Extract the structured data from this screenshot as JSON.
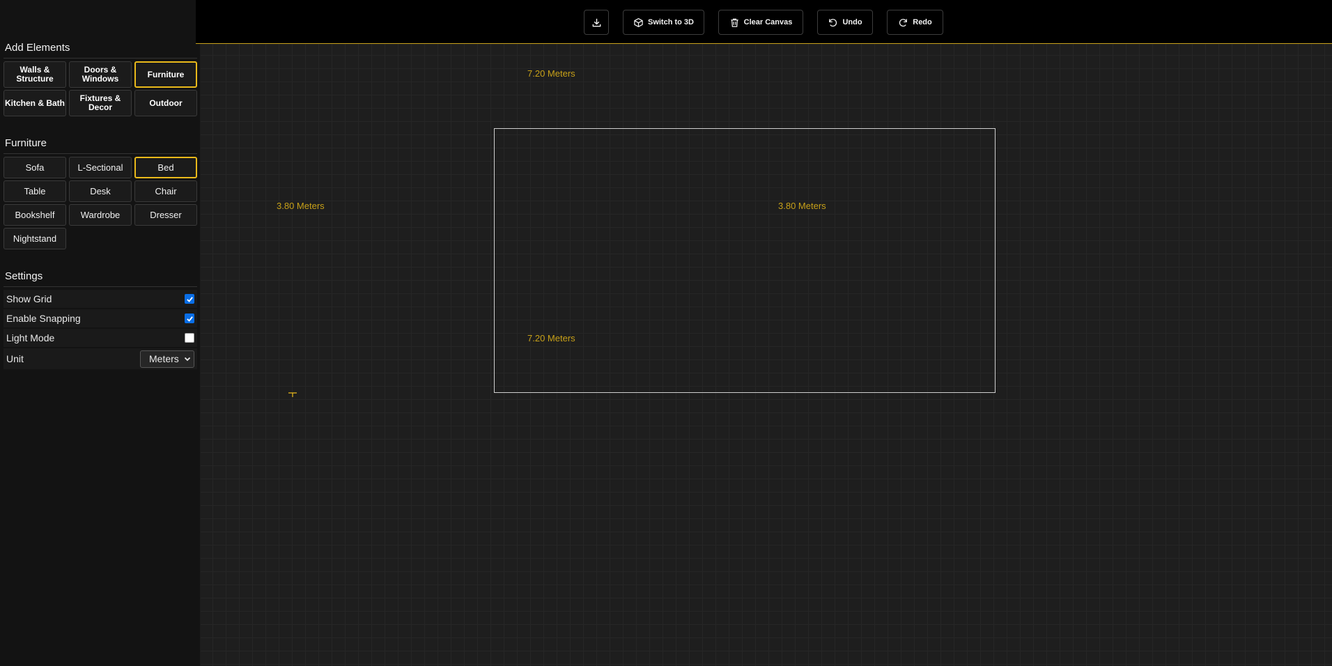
{
  "toolbar": {
    "buttons": [
      {
        "label": ""
      },
      {
        "label": "Switch to 3D"
      },
      {
        "label": "Clear Canvas"
      },
      {
        "label": "Undo"
      },
      {
        "label": "Redo"
      }
    ]
  },
  "sidebar": {
    "add_elements_title": "Add Elements",
    "categories": [
      {
        "label": "Walls & Structure",
        "active": false
      },
      {
        "label": "Doors & Windows",
        "active": false
      },
      {
        "label": "Furniture",
        "active": true
      },
      {
        "label": "Kitchen & Bath",
        "active": false
      },
      {
        "label": "Fixtures & Decor",
        "active": false
      },
      {
        "label": "Outdoor",
        "active": false
      }
    ],
    "furniture_title": "Furniture",
    "furniture_items": [
      {
        "label": "Sofa"
      },
      {
        "label": "L-Sectional"
      },
      {
        "label": "Bed",
        "active": true
      },
      {
        "label": "Table"
      },
      {
        "label": "Desk"
      },
      {
        "label": "Chair"
      },
      {
        "label": "Bookshelf"
      },
      {
        "label": "Wardrobe"
      },
      {
        "label": "Dresser"
      },
      {
        "label": "Nightstand"
      }
    ],
    "settings_title": "Settings",
    "settings": [
      {
        "label": "Show Grid",
        "checked": true
      },
      {
        "label": "Enable Snapping",
        "checked": true
      },
      {
        "label": "Light Mode",
        "checked": false
      }
    ],
    "unit": {
      "label": "Unit",
      "value": "Meters"
    }
  },
  "canvas": {
    "room": {
      "top_label": "7.20 Meters",
      "bottom_label": "7.20 Meters",
      "left_label": "3.80 Meters",
      "right_label": "3.80 Meters"
    }
  },
  "colors": {
    "accent": "#e9b91a",
    "dimension_text": "#c7a018",
    "checkbox_on": "#0a6ee6"
  }
}
